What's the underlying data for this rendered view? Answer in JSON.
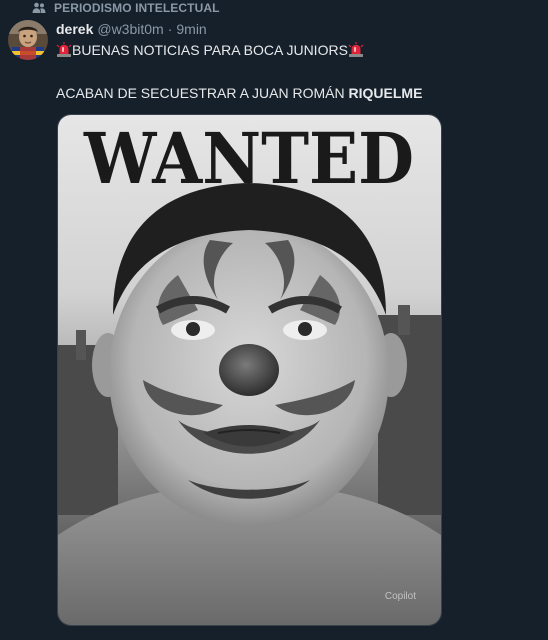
{
  "community": {
    "label": "PERIODISMO INTELECTUAL",
    "icon": "community-icon"
  },
  "author": {
    "display_name": "derek",
    "handle": "@w3bit0m",
    "separator": "·",
    "time": "9min"
  },
  "tweet": {
    "line1_text": "BUENAS NOTICIAS PARA BOCA JUNIORS",
    "line1_emoji": "police-light-emoji",
    "line2_text": "ACABAN DE SECUESTRAR A JUAN ROMÁN ",
    "line2_bold": "RIQUELME"
  },
  "media": {
    "poster_title": "WANTED",
    "watermark": "Copilot",
    "alt": "Black and white portrait of a man with clown face paint under the word WANTED"
  },
  "colors": {
    "background": "#15202b",
    "text_primary": "#e7e9ea",
    "text_secondary": "#8b98a5",
    "border": "#38444d"
  }
}
